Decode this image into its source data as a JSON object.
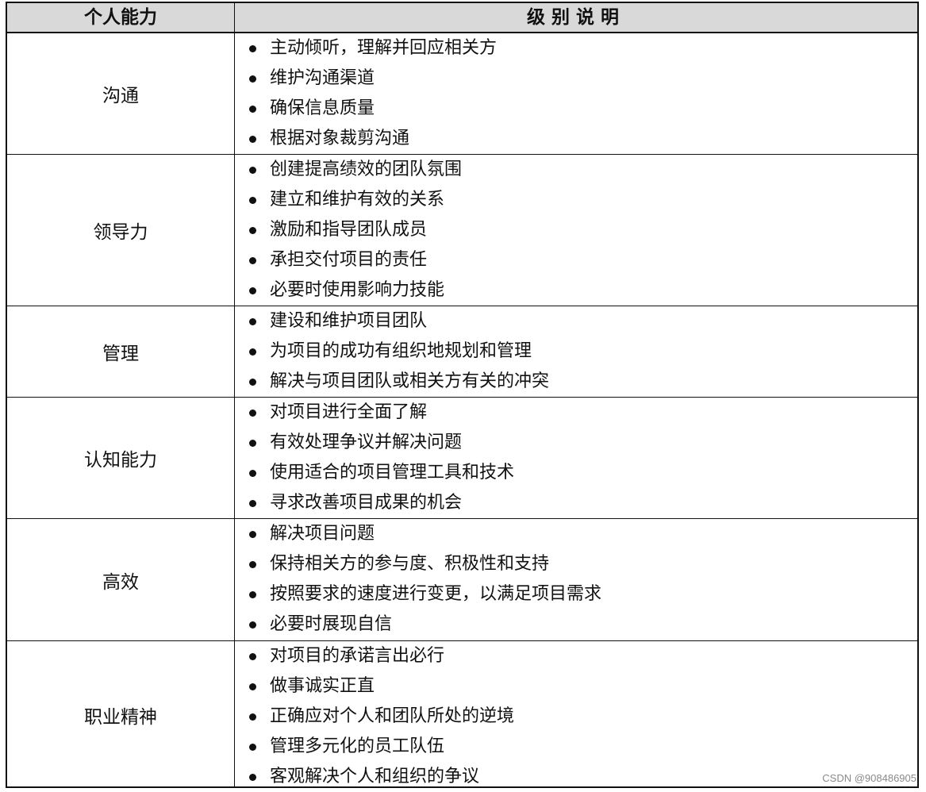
{
  "table": {
    "headers": [
      "个人能力",
      "级别说明"
    ],
    "rows": [
      {
        "name": "沟通",
        "items": [
          "主动倾听，理解并回应相关方",
          "维护沟通渠道",
          "确保信息质量",
          "根据对象裁剪沟通"
        ]
      },
      {
        "name": "领导力",
        "items": [
          "创建提高绩效的团队氛围",
          "建立和维护有效的关系",
          "激励和指导团队成员",
          "承担交付项目的责任",
          "必要时使用影响力技能"
        ]
      },
      {
        "name": "管理",
        "items": [
          "建设和维护项目团队",
          "为项目的成功有组织地规划和管理",
          "解决与项目团队或相关方有关的冲突"
        ]
      },
      {
        "name": "认知能力",
        "items": [
          "对项目进行全面了解",
          "有效处理争议并解决问题",
          "使用适合的项目管理工具和技术",
          "寻求改善项目成果的机会"
        ]
      },
      {
        "name": "高效",
        "items": [
          "解决项目问题",
          "保持相关方的参与度、积极性和支持",
          "按照要求的速度进行变更，以满足项目需求",
          "必要时展现自信"
        ]
      },
      {
        "name": "职业精神",
        "items": [
          "对项目的承诺言出必行",
          "做事诚实正直",
          "正确应对个人和团队所处的逆境",
          "管理多元化的员工队伍",
          "客观解决个人和组织的争议"
        ]
      }
    ]
  },
  "watermark": "CSDN @908486905"
}
